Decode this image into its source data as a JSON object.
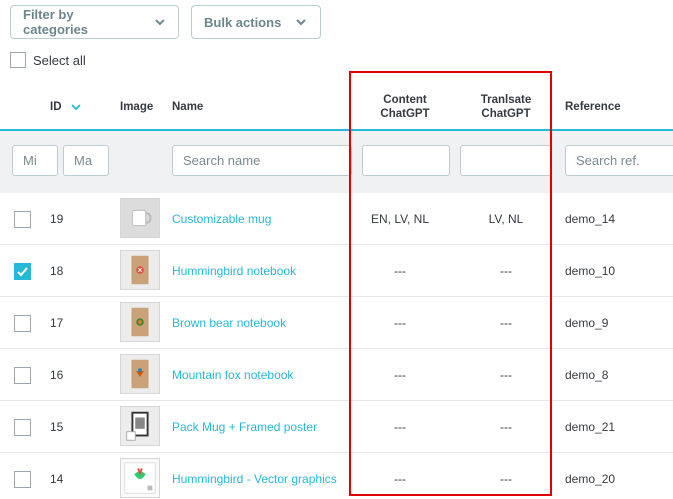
{
  "toolbar": {
    "filter_label": "Filter by categories",
    "bulk_label": "Bulk actions"
  },
  "select_all_label": "Select all",
  "columns": {
    "id": "ID",
    "image": "Image",
    "name": "Name",
    "content_line1": "Content",
    "content_line2": "ChatGPT",
    "translate_line1": "Tranlsate",
    "translate_line2": "ChatGPT",
    "reference": "Reference"
  },
  "filters": {
    "id_min_placeholder": "Mi",
    "id_max_placeholder": "Ma",
    "name_placeholder": "Search name",
    "content_placeholder": "",
    "translate_placeholder": "",
    "ref_placeholder": "Search ref."
  },
  "rows": [
    {
      "id": "19",
      "name": "Customizable mug",
      "content": "EN, LV, NL",
      "translate": "LV, NL",
      "reference": "demo_14",
      "checked": false
    },
    {
      "id": "18",
      "name": "Hummingbird notebook",
      "content": "---",
      "translate": "---",
      "reference": "demo_10",
      "checked": true
    },
    {
      "id": "17",
      "name": "Brown bear notebook",
      "content": "---",
      "translate": "---",
      "reference": "demo_9",
      "checked": false
    },
    {
      "id": "16",
      "name": "Mountain fox notebook",
      "content": "---",
      "translate": "---",
      "reference": "demo_8",
      "checked": false
    },
    {
      "id": "15",
      "name": "Pack Mug + Framed poster",
      "content": "---",
      "translate": "---",
      "reference": "demo_21",
      "checked": false
    },
    {
      "id": "14",
      "name": "Hummingbird - Vector graphics",
      "content": "---",
      "translate": "---",
      "reference": "demo_20",
      "checked": false
    }
  ],
  "colors": {
    "accent": "#25b9d7",
    "highlight": "#e30000",
    "filter_bg": "#eff1f2"
  }
}
